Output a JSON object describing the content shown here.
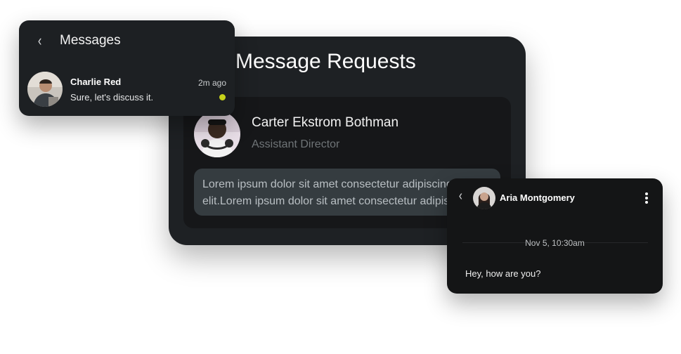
{
  "requests": {
    "title": "Message Requests",
    "item": {
      "name": "Carter Ekstrom Bothman",
      "role": "Assistant Director",
      "message_line1": "Lorem ipsum dolor sit amet consectetur adipiscing",
      "message_line2": "elit.Lorem ipsum dolor sit amet consectetur adipiscing"
    }
  },
  "messages": {
    "back_icon": "chevron-left-icon",
    "title": "Messages",
    "conversation": {
      "name": "Charlie Red",
      "preview": "Sure, let's discuss it.",
      "time": "2m ago",
      "unread_dot_color": "#c6d21a"
    }
  },
  "chat": {
    "back_icon": "chevron-left-icon",
    "contact_name": "Aria Montgomery",
    "menu_icon": "more-vertical-icon",
    "date_separator": "Nov 5, 10:30am",
    "message": "Hey, how are you?"
  },
  "colors": {
    "card_dark": "#1e2124",
    "accent_dot": "#c6d21a"
  }
}
